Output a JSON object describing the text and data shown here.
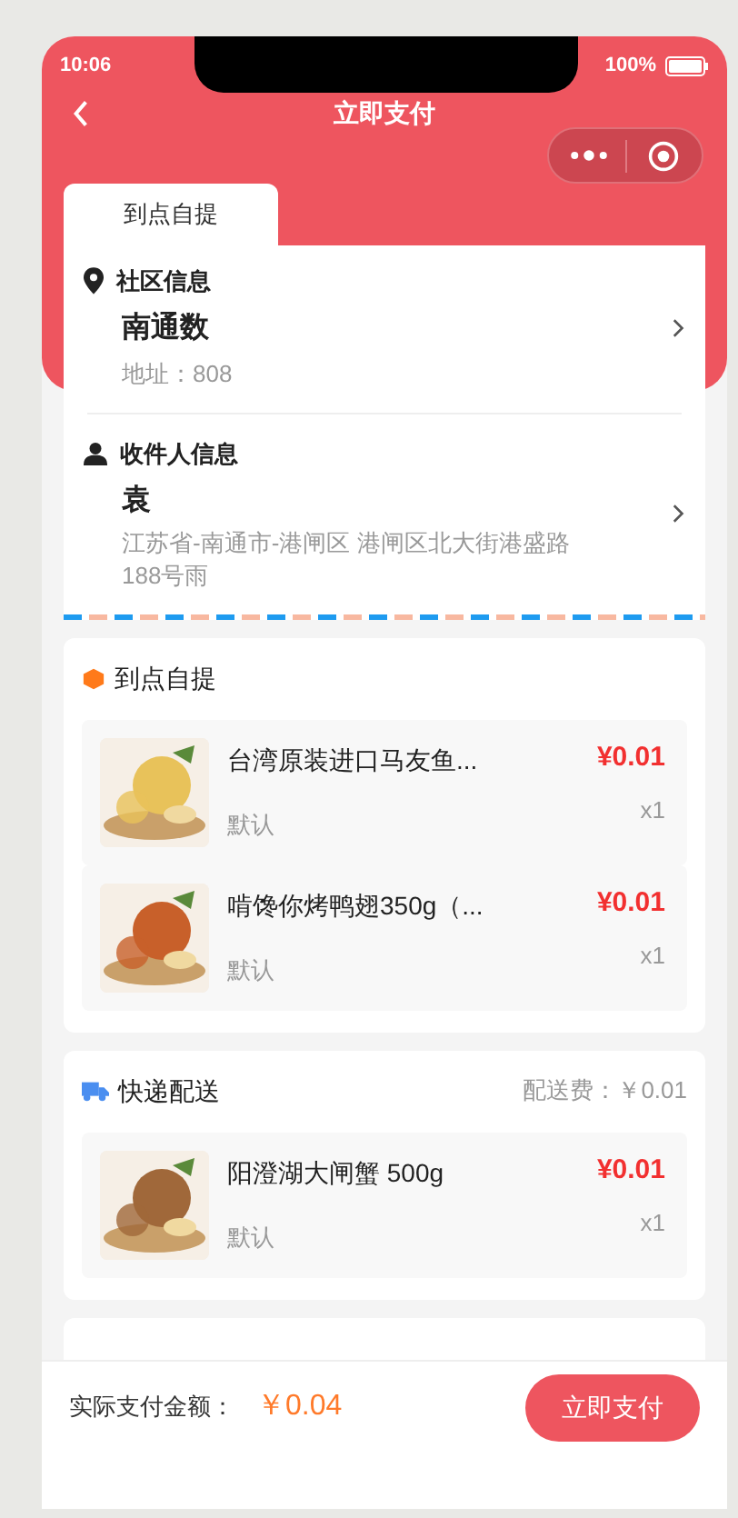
{
  "status_bar": {
    "time": "10:06",
    "battery": "100%"
  },
  "nav": {
    "title": "立即支付"
  },
  "tabs": [
    {
      "label": "到点自提",
      "selected": true
    }
  ],
  "community": {
    "heading": "社区信息",
    "name": "南通数",
    "address": "地址：808"
  },
  "recipient": {
    "heading": "收件人信息",
    "name": "袁",
    "address": "江苏省-南通市-港闸区 港闸区北大街港盛路188号雨"
  },
  "sections": [
    {
      "kind": "pickup",
      "title": "到点自提",
      "items": [
        {
          "name": "台湾原装进口马友鱼...",
          "spec": "默认",
          "price": "¥0.01",
          "qty": "x1"
        },
        {
          "name": "啃馋你烤鸭翅350g（...",
          "spec": "默认",
          "price": "¥0.01",
          "qty": "x1"
        }
      ]
    },
    {
      "kind": "express",
      "title": "快递配送",
      "fee": "配送费：￥0.01",
      "items": [
        {
          "name": "阳澄湖大闸蟹 500g",
          "spec": "默认",
          "price": "¥0.01",
          "qty": "x1"
        }
      ]
    }
  ],
  "footer": {
    "label": "实际支付金额：",
    "total": "￥0.04",
    "button": "立即支付"
  }
}
